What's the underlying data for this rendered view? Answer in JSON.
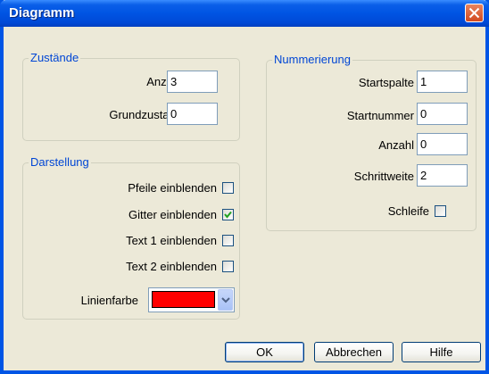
{
  "window": {
    "title": "Diagramm",
    "close_icon": "close-icon"
  },
  "zustaende": {
    "legend": "Zustände",
    "anzahl_label": "Anzahl",
    "anzahl_value": "3",
    "grundzustand_label": "Grundzustand",
    "grundzustand_value": "0"
  },
  "darstellung": {
    "legend": "Darstellung",
    "checkboxes": [
      {
        "label": "Pfeile einblenden",
        "checked": false
      },
      {
        "label": "Gitter einblenden",
        "checked": true
      },
      {
        "label": "Text 1 einblenden",
        "checked": false
      },
      {
        "label": "Text 2 einblenden",
        "checked": false
      }
    ],
    "linienfarbe_label": "Linienfarbe",
    "linienfarbe_color": "#ff0000"
  },
  "nummerierung": {
    "legend": "Nummerierung",
    "startspalte_label": "Startspalte",
    "startspalte_value": "1",
    "startnummer_label": "Startnummer",
    "startnummer_value": "0",
    "anzahl_label": "Anzahl",
    "anzahl_value": "0",
    "schrittweite_label": "Schrittweite",
    "schrittweite_value": "2",
    "schleife_label": "Schleife",
    "schleife_checked": false
  },
  "buttons": {
    "ok": "OK",
    "cancel": "Abbrechen",
    "help": "Hilfe"
  },
  "colors": {
    "title_bar": "#0054e3",
    "dialog_bg": "#ece9d8",
    "legend": "#0046d5",
    "check": "#21a121"
  }
}
